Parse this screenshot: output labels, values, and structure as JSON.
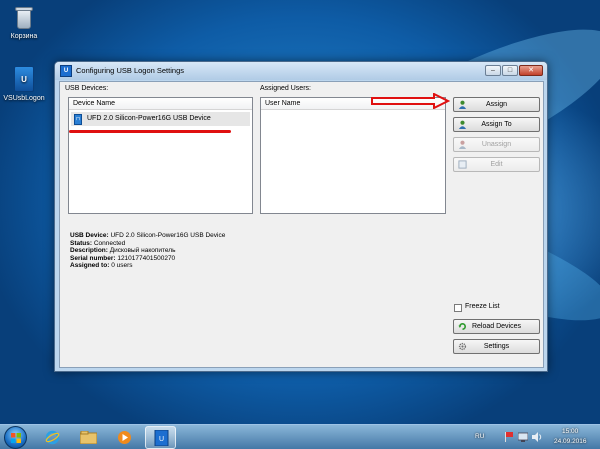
{
  "desktop": {
    "icons": [
      {
        "label": "Корзина",
        "icon": "recycle-bin-icon"
      },
      {
        "label": "VSUsbLogon",
        "icon": "usb-logon-app-icon"
      }
    ]
  },
  "window": {
    "title": "Configuring USB Logon Settings",
    "controls": {
      "minimize": "–",
      "maximize": "□",
      "close": "✕"
    },
    "usb_devices": {
      "label": "USB Devices:",
      "column_header": "Device Name",
      "items": [
        {
          "name": "UFD 2.0 Silicon-Power16G USB Device"
        }
      ]
    },
    "assigned_users": {
      "label": "Assigned Users:",
      "column_header": "User Name"
    },
    "buttons": {
      "assign": "Assign",
      "assign_to": "Assign To",
      "unassign": "Unassign",
      "edit": "Edit",
      "reload": "Reload Devices",
      "settings": "Settings"
    },
    "freeze_list": {
      "label": "Freeze List",
      "checked": false
    },
    "info": {
      "device_label": "USB Device:",
      "device_value": "UFD 2.0 Silicon-Power16G USB Device",
      "status_label": "Status:",
      "status_value": "Connected",
      "description_label": "Description:",
      "description_value": "Дисковый накопитель",
      "serial_label": "Serial number:",
      "serial_value": "1210177401500270",
      "assigned_label": "Assigned to:",
      "assigned_value": "0 users"
    }
  },
  "taskbar": {
    "language": "RU",
    "time": "15:00",
    "date": "24.09.2016"
  },
  "colors": {
    "annotation_red": "#e01010",
    "window_frame": "#bcd6ee"
  }
}
